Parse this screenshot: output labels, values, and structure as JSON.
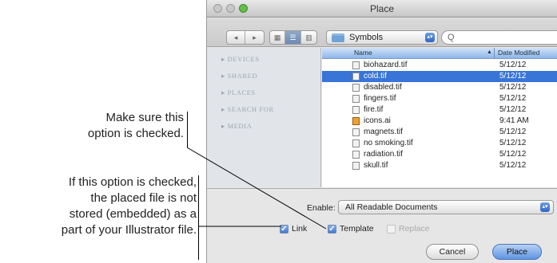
{
  "callouts": {
    "first": {
      "line1": "Make sure this",
      "line2": "option is checked."
    },
    "second": {
      "line1": "If this option is checked,",
      "line2": "the placed file is not",
      "line3": "stored (embedded) as a",
      "line4": "part of your Illustrator file."
    }
  },
  "window": {
    "title": "Place"
  },
  "toolbar": {
    "back_glyph": "◂",
    "forward_glyph": "▸",
    "view_icon_glyph": "▦",
    "view_list_glyph": "☰",
    "view_column_glyph": "▥",
    "location": "Symbols",
    "search_glyph": "Q",
    "stepper_glyph": "▴▾"
  },
  "sidebar": {
    "items": [
      {
        "label": "▸ DEVICES"
      },
      {
        "label": "▸ SHARED"
      },
      {
        "label": "▸ PLACES"
      },
      {
        "label": "▸ SEARCH FOR"
      },
      {
        "label": "▸ MEDIA"
      }
    ]
  },
  "file_list": {
    "columns": {
      "name": "Name",
      "date": "Date Modified",
      "sort_glyph": "▲"
    },
    "rows": [
      {
        "name": "biohazard.tif",
        "date": "5/12/12",
        "selected": false,
        "type": "tif"
      },
      {
        "name": "cold.tif",
        "date": "5/12/12",
        "selected": true,
        "type": "tif"
      },
      {
        "name": "disabled.tif",
        "date": "5/12/12",
        "selected": false,
        "type": "tif"
      },
      {
        "name": "fingers.tif",
        "date": "5/12/12",
        "selected": false,
        "type": "tif"
      },
      {
        "name": "fire.tif",
        "date": "5/12/12",
        "selected": false,
        "type": "tif"
      },
      {
        "name": "icons.ai",
        "date": "9:41 AM",
        "selected": false,
        "type": "ai"
      },
      {
        "name": "magnets.tif",
        "date": "5/12/12",
        "selected": false,
        "type": "tif"
      },
      {
        "name": "no smoking.tif",
        "date": "5/12/12",
        "selected": false,
        "type": "tif"
      },
      {
        "name": "radiation.tif",
        "date": "5/12/12",
        "selected": false,
        "type": "tif"
      },
      {
        "name": "skull.tif",
        "date": "5/12/12",
        "selected": false,
        "type": "tif"
      }
    ]
  },
  "options": {
    "enable_label": "Enable:",
    "enable_value": "All Readable Documents",
    "link": {
      "label": "Link",
      "checked": true
    },
    "template": {
      "label": "Template",
      "checked": true
    },
    "replace": {
      "label": "Replace",
      "checked": false,
      "disabled": true
    },
    "check_glyph": "✓"
  },
  "buttons": {
    "cancel": "Cancel",
    "place": "Place"
  },
  "colors": {
    "selection": "#3875d7",
    "zoom_button": "#63c04a",
    "primary_button": "#5e95e2"
  }
}
